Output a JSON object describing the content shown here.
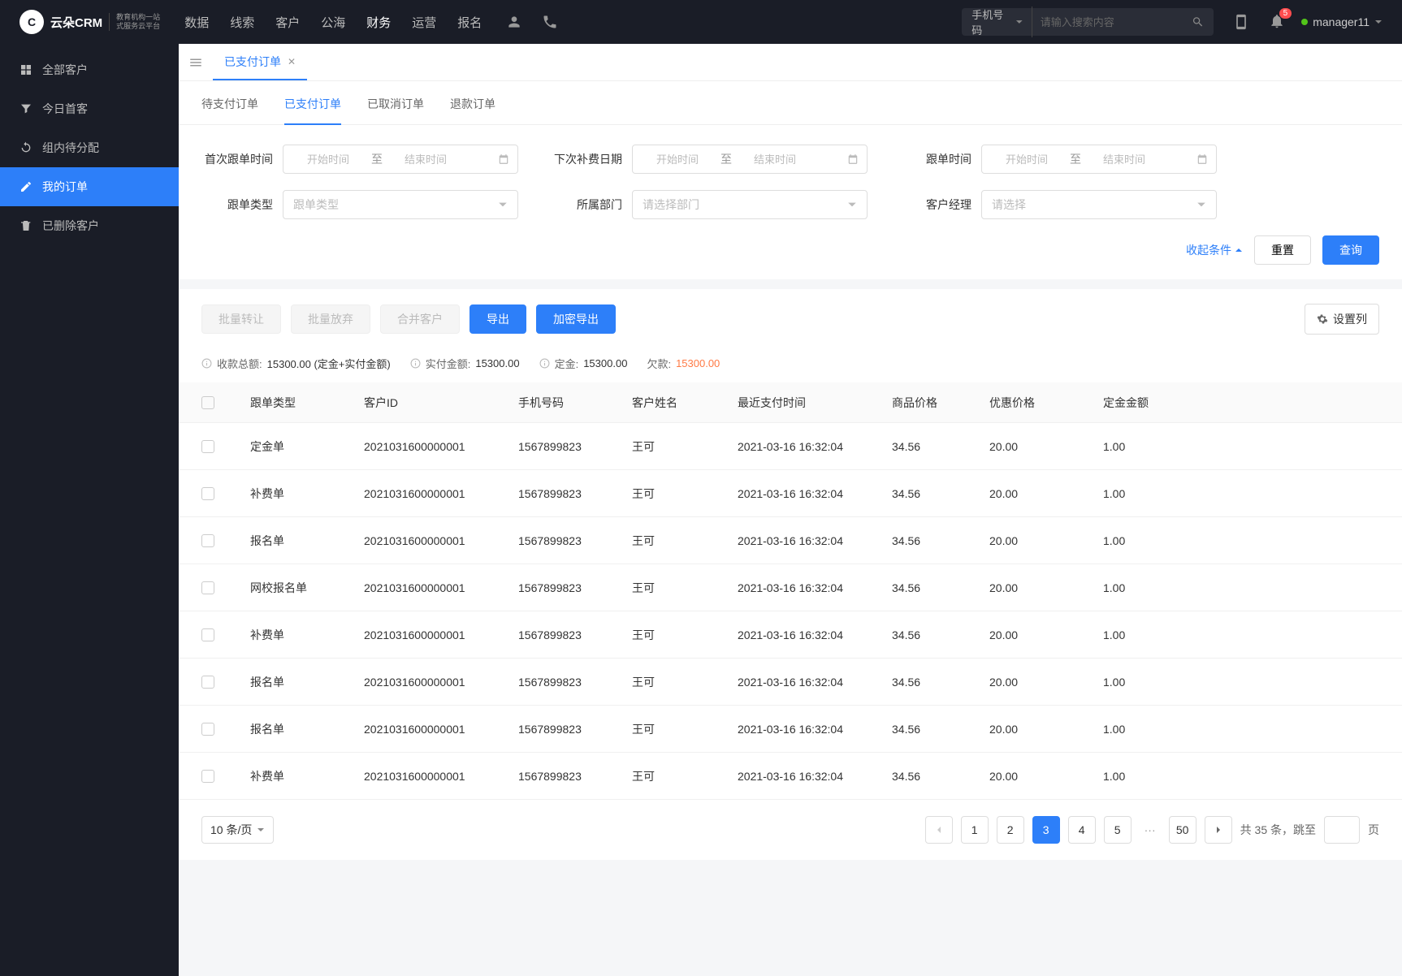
{
  "brand": {
    "name": "云朵CRM",
    "sub1": "教育机构一站",
    "sub2": "式服务云平台"
  },
  "nav": {
    "items": [
      "数据",
      "线索",
      "客户",
      "公海",
      "财务",
      "运营",
      "报名"
    ],
    "activeIndex": 4
  },
  "search": {
    "type": "手机号码",
    "placeholder": "请输入搜索内容"
  },
  "notifications": {
    "count": 5
  },
  "user": {
    "name": "manager11"
  },
  "sidebar": {
    "items": [
      {
        "label": "全部客户",
        "icon": "grid"
      },
      {
        "label": "今日首客",
        "icon": "funnel"
      },
      {
        "label": "组内待分配",
        "icon": "refresh"
      },
      {
        "label": "我的订单",
        "icon": "edit"
      },
      {
        "label": "已删除客户",
        "icon": "trash"
      }
    ],
    "activeIndex": 3
  },
  "fileTab": {
    "label": "已支付订单"
  },
  "subTabs": {
    "items": [
      "待支付订单",
      "已支付订单",
      "已取消订单",
      "退款订单"
    ],
    "activeIndex": 1
  },
  "filters": {
    "firstFollowTime": {
      "label": "首次跟单时间",
      "startPh": "开始时间",
      "endPh": "结束时间",
      "sep": "至"
    },
    "nextChargeDate": {
      "label": "下次补费日期",
      "startPh": "开始时间",
      "endPh": "结束时间",
      "sep": "至"
    },
    "followTime": {
      "label": "跟单时间",
      "startPh": "开始时间",
      "endPh": "结束时间",
      "sep": "至"
    },
    "followType": {
      "label": "跟单类型",
      "placeholder": "跟单类型"
    },
    "department": {
      "label": "所属部门",
      "placeholder": "请选择部门"
    },
    "manager": {
      "label": "客户经理",
      "placeholder": "请选择"
    },
    "collapse": "收起条件",
    "reset": "重置",
    "query": "查询"
  },
  "toolbar": {
    "batchTransfer": "批量转让",
    "batchAbandon": "批量放弃",
    "mergeCustomer": "合并客户",
    "export": "导出",
    "encryptedExport": "加密导出",
    "setColumns": "设置列"
  },
  "summary": {
    "totalLabel": "收款总额:",
    "totalValue": "15300.00 (定金+实付金额)",
    "paidLabel": "实付金额:",
    "paidValue": "15300.00",
    "depositLabel": "定金:",
    "depositValue": "15300.00",
    "owedLabel": "欠款:",
    "owedValue": "15300.00"
  },
  "table": {
    "headers": [
      "跟单类型",
      "客户ID",
      "手机号码",
      "客户姓名",
      "最近支付时间",
      "商品价格",
      "优惠价格",
      "定金金额"
    ],
    "rows": [
      {
        "type": "定金单",
        "customerId": "2021031600000001",
        "phone": "1567899823",
        "name": "王可",
        "lastPaid": "2021-03-16 16:32:04",
        "price": "34.56",
        "discount": "20.00",
        "deposit": "1.00"
      },
      {
        "type": "补费单",
        "customerId": "2021031600000001",
        "phone": "1567899823",
        "name": "王可",
        "lastPaid": "2021-03-16 16:32:04",
        "price": "34.56",
        "discount": "20.00",
        "deposit": "1.00"
      },
      {
        "type": "报名单",
        "customerId": "2021031600000001",
        "phone": "1567899823",
        "name": "王可",
        "lastPaid": "2021-03-16 16:32:04",
        "price": "34.56",
        "discount": "20.00",
        "deposit": "1.00"
      },
      {
        "type": "网校报名单",
        "customerId": "2021031600000001",
        "phone": "1567899823",
        "name": "王可",
        "lastPaid": "2021-03-16 16:32:04",
        "price": "34.56",
        "discount": "20.00",
        "deposit": "1.00"
      },
      {
        "type": "补费单",
        "customerId": "2021031600000001",
        "phone": "1567899823",
        "name": "王可",
        "lastPaid": "2021-03-16 16:32:04",
        "price": "34.56",
        "discount": "20.00",
        "deposit": "1.00"
      },
      {
        "type": "报名单",
        "customerId": "2021031600000001",
        "phone": "1567899823",
        "name": "王可",
        "lastPaid": "2021-03-16 16:32:04",
        "price": "34.56",
        "discount": "20.00",
        "deposit": "1.00"
      },
      {
        "type": "报名单",
        "customerId": "2021031600000001",
        "phone": "1567899823",
        "name": "王可",
        "lastPaid": "2021-03-16 16:32:04",
        "price": "34.56",
        "discount": "20.00",
        "deposit": "1.00"
      },
      {
        "type": "补费单",
        "customerId": "2021031600000001",
        "phone": "1567899823",
        "name": "王可",
        "lastPaid": "2021-03-16 16:32:04",
        "price": "34.56",
        "discount": "20.00",
        "deposit": "1.00"
      }
    ]
  },
  "pagination": {
    "pageSize": "10 条/页",
    "pages": [
      "1",
      "2",
      "3",
      "4",
      "5"
    ],
    "lastPage": "50",
    "activeIndex": 2,
    "totalPrefix": "共",
    "totalCount": "35",
    "totalSuffix": "条，跳至",
    "pageSuffix": "页"
  }
}
